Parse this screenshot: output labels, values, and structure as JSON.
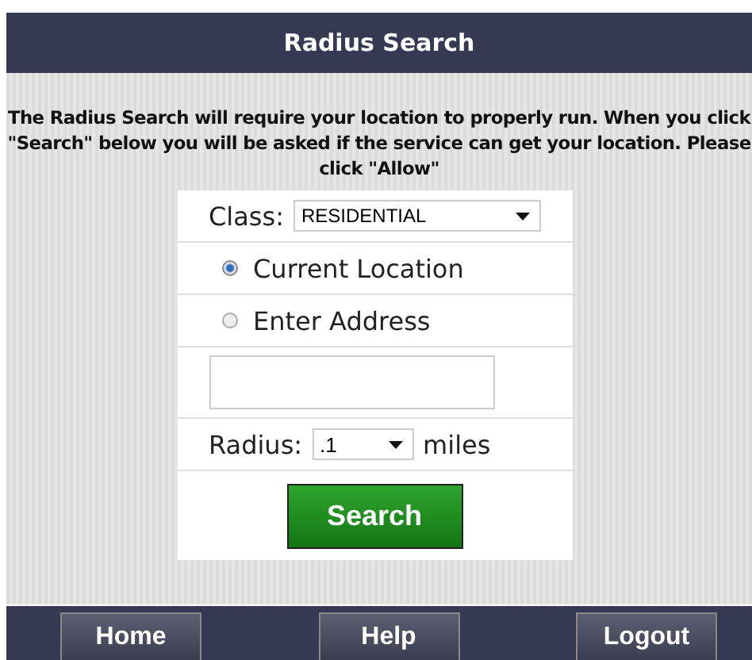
{
  "header": {
    "title": "Radius Search"
  },
  "notice": "The Radius Search will require your location to properly run. When you click \"Search\" below you will be asked if the service can get your location. Please click \"Allow\"",
  "form": {
    "class_label": "Class:",
    "class_value": "RESIDENTIAL",
    "location_options": [
      {
        "label": "Current Location",
        "selected": true
      },
      {
        "label": "Enter Address",
        "selected": false
      }
    ],
    "radius_label": "Radius:",
    "radius_value": ".1",
    "radius_unit": "miles",
    "search_button": "Search"
  },
  "footer_buttons": [
    "Home",
    "Help",
    "Logout"
  ]
}
